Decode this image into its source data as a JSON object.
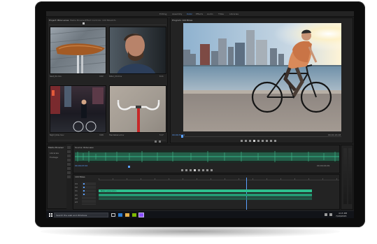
{
  "app": {
    "workspaces": [
      "Editing",
      "Assembly",
      "Color",
      "Effects",
      "Audio",
      "Titles",
      "Libraries"
    ],
    "active_workspace": "Color"
  },
  "project_panel": {
    "tabs": [
      "Project: Bike Lanes",
      "Media Browser",
      "Effect Controls: 100 Bikes",
      "Info"
    ],
    "clips": [
      {
        "name": "Seat_01.mov",
        "duration": "4:22"
      },
      {
        "name": "Rider_CU.mov",
        "duration": "6:11"
      },
      {
        "name": "Night_Ride.mov",
        "duration": "3:08"
      },
      {
        "name": "Handlebars.mov",
        "duration": "5:17"
      }
    ]
  },
  "program_monitor": {
    "title": "Program: 100 Bikes",
    "timecode_in": "00;00;37;01",
    "timecode_out": "00;01;24;18"
  },
  "source_monitor": {
    "title": "Source: Rider.wav",
    "timecode_in": "00;00;07;02",
    "timecode_out": "00;00;44;09"
  },
  "media_panel": {
    "title": "Media Browser",
    "items": [
      "Libraries",
      "Footage"
    ]
  },
  "timeline": {
    "sequence_name": "100 Bikes",
    "tracks": [
      "V3",
      "V2",
      "V1",
      "A1",
      "A2",
      "A3"
    ],
    "clip_label": "Bike Lane Intro"
  },
  "taskbar": {
    "search_placeholder": "Search the web and Windows",
    "time": "4:15 PM",
    "date": "7/29/2015"
  },
  "colors": {
    "accent_blue": "#5aa0ff",
    "clip_green": "#2ec08e",
    "waveform_green": "#2b8c6a",
    "panel_bg": "#232323"
  }
}
